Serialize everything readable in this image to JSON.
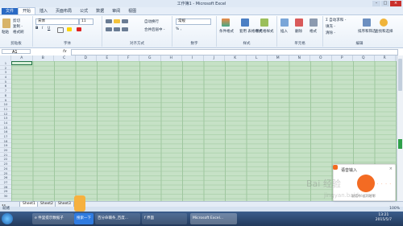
{
  "window": {
    "title": "工作簿1 - Microsoft Excel",
    "min": "–",
    "max": "□",
    "close": "×"
  },
  "ribbon_tabs": [
    "文件",
    "开始",
    "插入",
    "页面布局",
    "公式",
    "数据",
    "审阅",
    "视图"
  ],
  "ribbon": {
    "clipboard": {
      "label": "剪贴板",
      "cut": "剪切",
      "copy": "复制 -",
      "format_painter": "格式刷",
      "paste": "粘贴"
    },
    "font": {
      "label": "字体",
      "font_name": "宋体",
      "font_size": "11"
    },
    "alignment": {
      "label": "对齐方式",
      "wrap": "自动换行",
      "merge": "合并后居中 -"
    },
    "number": {
      "label": "数字",
      "format": "常规",
      "percent": "% ,"
    },
    "styles": {
      "label": "样式",
      "conditional": "条件格式",
      "table": "套用\n表格格式",
      "cell_styles": "单元格样式"
    },
    "cells": {
      "label": "单元格",
      "insert": "插入",
      "delete": "删除",
      "format": "格式"
    },
    "editing": {
      "label": "编辑",
      "autosum": "Σ 自动求和 -",
      "fill": "填充 -",
      "clear": "清除 -",
      "sort": "排序和筛选",
      "find": "查找和选择"
    }
  },
  "formula_bar": {
    "name_box": "A1",
    "fx": "fx",
    "value": ""
  },
  "columns": [
    "A",
    "B",
    "C",
    "D",
    "E",
    "F",
    "G",
    "H",
    "I",
    "J",
    "K",
    "L",
    "M",
    "N",
    "O",
    "P",
    "Q",
    "R"
  ],
  "rows": [
    "1",
    "2",
    "3",
    "4",
    "5",
    "6",
    "7",
    "8",
    "9",
    "10",
    "11",
    "12",
    "13",
    "14",
    "15",
    "16",
    "17",
    "18",
    "19",
    "20",
    "21",
    "22",
    "23",
    "24",
    "25",
    "26",
    "27",
    "28",
    "29",
    "30"
  ],
  "sheets": [
    "Sheet1",
    "Sheet2",
    "Sheet3"
  ],
  "status": {
    "ready": "就绪",
    "zoom": "100%"
  },
  "ime": {
    "title": "语音输入",
    "hint": "说话中 松开结束",
    "dots": "· · · · ·"
  },
  "taskbar": {
    "items": [
      "e 件里提示数据子",
      "搜索一下",
      "百分命输条_百度...",
      "f 界面",
      "Microsoft Excel..."
    ],
    "time": "13:21",
    "date": "2015/5/7"
  },
  "watermark": "Bai 经验 jingyan.baidu.com",
  "colors": {
    "grid": "#c6e1c6",
    "accent": "#2a6ac4",
    "excel_green": "#217346"
  }
}
